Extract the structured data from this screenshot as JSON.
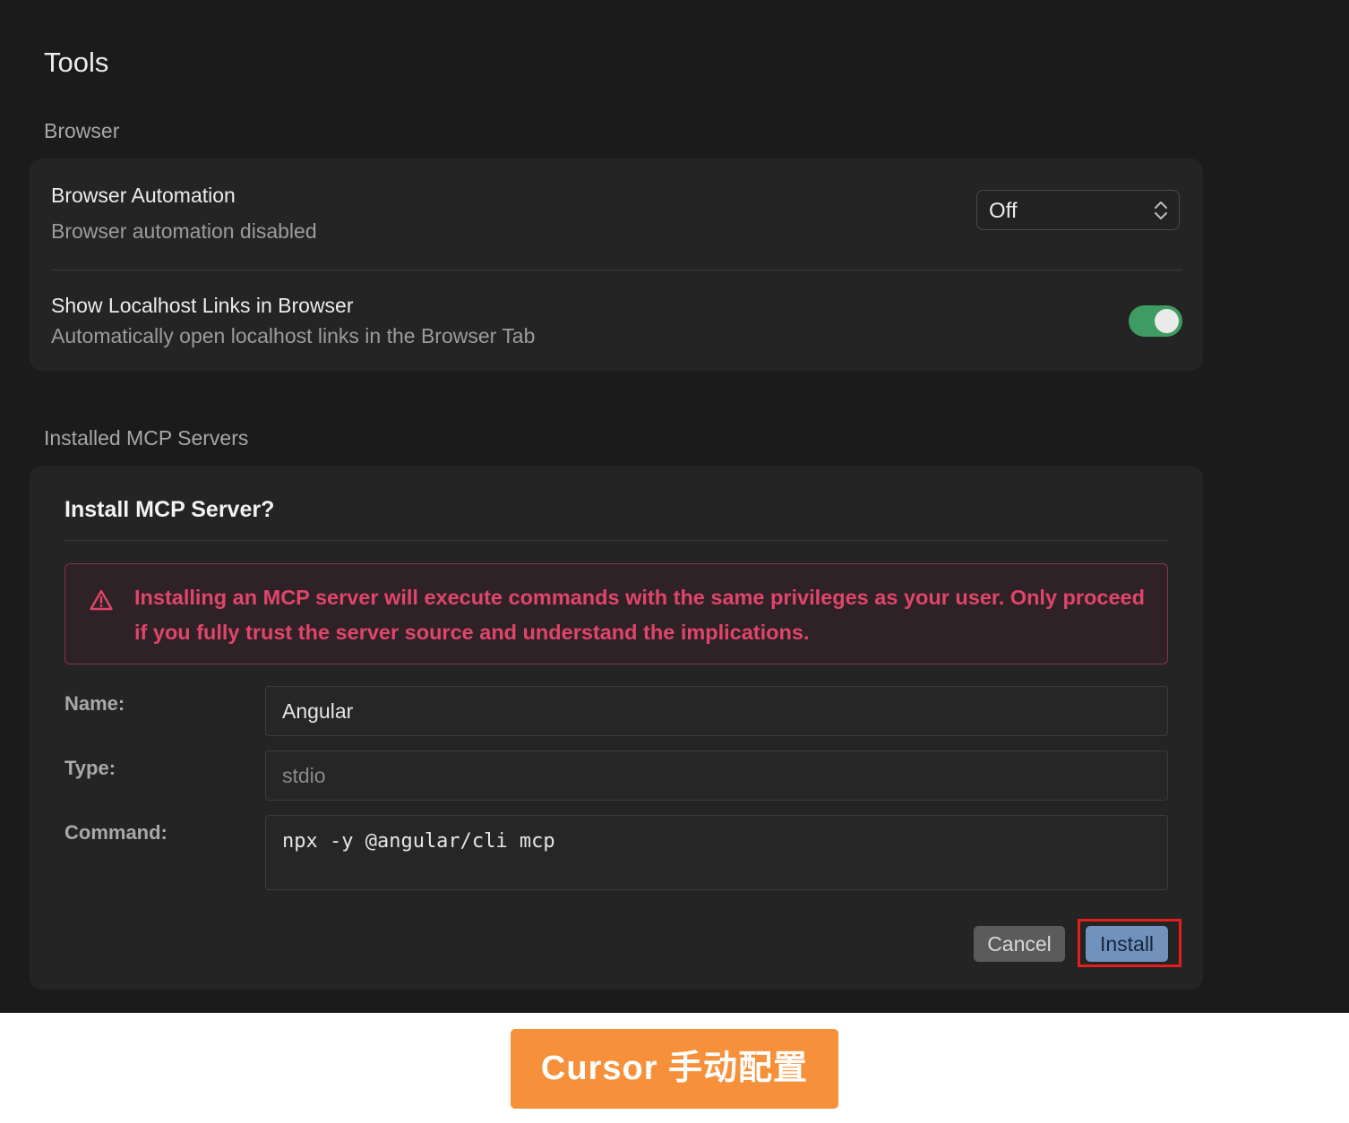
{
  "page": {
    "title": "Tools"
  },
  "browser_section": {
    "label": "Browser",
    "automation": {
      "title": "Browser Automation",
      "description": "Browser automation disabled",
      "select_value": "Off"
    },
    "localhost": {
      "title": "Show Localhost Links in Browser",
      "description": "Automatically open localhost links in the Browser Tab",
      "toggle_on": true
    }
  },
  "mcp_section": {
    "label": "Installed MCP Servers",
    "dialog": {
      "title": "Install MCP Server?",
      "warning": "Installing an MCP server will execute commands with the same privileges as your user. Only proceed if you fully trust the server source and understand the implications.",
      "name_label": "Name:",
      "name_value": "Angular",
      "type_label": "Type:",
      "type_value": "stdio",
      "command_label": "Command:",
      "command_value": "npx -y @angular/cli mcp",
      "cancel_label": "Cancel",
      "install_label": "Install"
    }
  },
  "caption": {
    "text": "Cursor 手动配置"
  },
  "colors": {
    "background": "#1b1b1b",
    "card": "#242424",
    "toggle_on": "#3e9b62",
    "warning_text": "#e0456a",
    "install_button": "#7092bd",
    "highlight": "#e41d1d",
    "caption_banner": "#f7903a"
  },
  "icons": {
    "select": "chevron-up-down-icon",
    "warning": "warning-triangle-icon"
  }
}
